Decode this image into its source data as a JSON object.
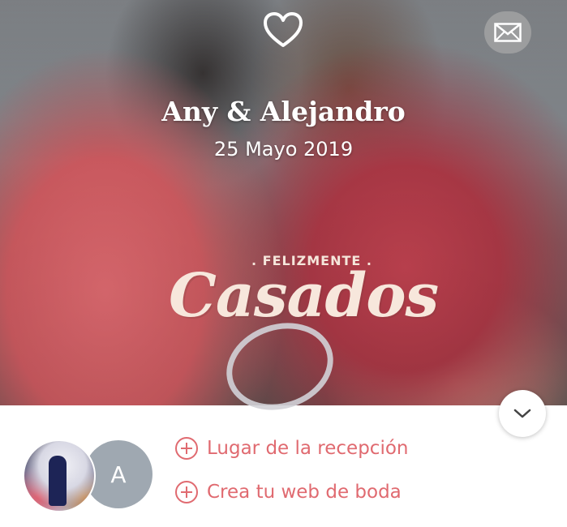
{
  "hero": {
    "names": "Any & Alejandro",
    "date": "25 Mayo 2019",
    "badge_top": ". FELIZMENTE .",
    "badge_main": "Casados"
  },
  "icons": {
    "heart": "heart-icon",
    "mail": "mail-icon",
    "scroll": "chevron-down-icon",
    "plus": "plus-circle-icon"
  },
  "profile": {
    "avatar_letter": "A"
  },
  "links": [
    {
      "label": "Lugar de la recepción"
    },
    {
      "label": "Crea tu web de boda"
    }
  ],
  "colors": {
    "accent": "#e06a70",
    "avatar_bg": "#9fa8b1"
  }
}
